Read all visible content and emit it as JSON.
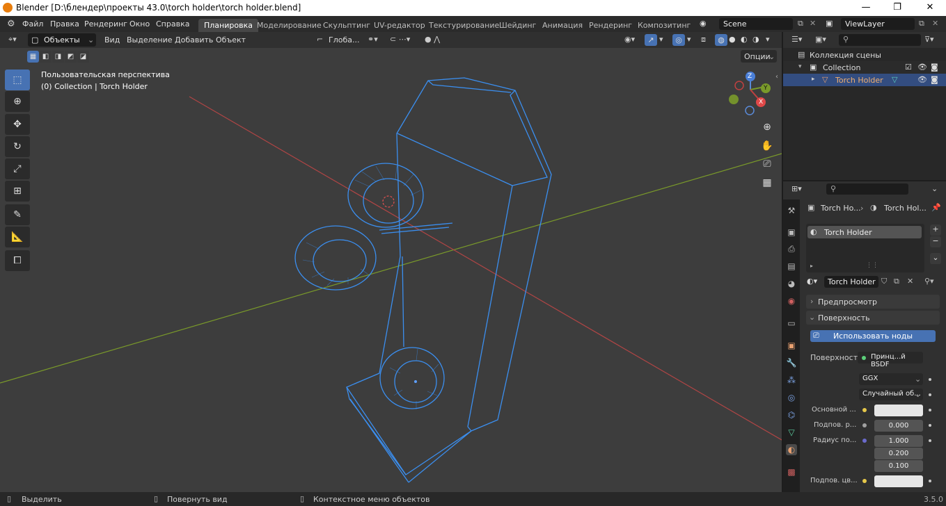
{
  "window": {
    "title": "Blender [D:\\блендер\\проекты 43.0\\torch holder\\torch holder.blend]",
    "minimize": "—",
    "maximize": "❐",
    "close": "✕"
  },
  "menu": {
    "items": [
      "Файл",
      "Правка",
      "Рендеринг",
      "Окно",
      "Справка"
    ]
  },
  "workspaces": {
    "tabs": [
      "Планировка",
      "Моделирование",
      "Скульптинг",
      "UV-редактор",
      "Текстурирование",
      "Шейдинг",
      "Анимация",
      "Рендеринг",
      "Композитинг"
    ],
    "active": "Планировка"
  },
  "scene": {
    "name": "Scene",
    "view_layer": "ViewLayer"
  },
  "viewport_header": {
    "mode": "Объекты",
    "menus": [
      "Вид",
      "Выделение",
      "Добавить",
      "Объект"
    ],
    "transform_orientation": "Глоба...",
    "options_label": "Опции"
  },
  "viewport": {
    "perspective_label": "Пользовательская перспектива",
    "collection_label": "(0) Collection | Torch Holder",
    "gizmo": {
      "x": "X",
      "y": "Y",
      "z": "Z"
    }
  },
  "outliner": {
    "scene_collection": "Коллекция сцены",
    "collection": "Collection",
    "object": "Torch Holder"
  },
  "properties": {
    "breadcrumb": [
      "Torch Ho...",
      "Torch Hol..."
    ],
    "material_slot": "Torch Holder",
    "material_name": "Torch Holder",
    "sections": {
      "preview": "Предпросмотр",
      "surface": "Поверхность"
    },
    "use_nodes_button": "Использовать ноды",
    "surface_label": "Поверхность",
    "surface_shader": "Принц...й BSDF",
    "distribution": "GGX",
    "subsurface_method": "Случайный об...",
    "rows": [
      {
        "label": "Основной ...",
        "value": ""
      },
      {
        "label": "Подпов. р...",
        "value": "0.000"
      },
      {
        "label": "Радиус по...",
        "value": "1.000"
      },
      {
        "label": "",
        "value": "0.200"
      },
      {
        "label": "",
        "value": "0.100"
      },
      {
        "label": "Подпов. цв...",
        "value": ""
      }
    ]
  },
  "statusbar": {
    "select": "Выделить",
    "rotate": "Повернуть вид",
    "context": "Контекстное меню объектов",
    "version": "3.5.0"
  },
  "colors": {
    "accent": "#4772b3",
    "wire": "#3b8ff0",
    "x_axis": "#c04040",
    "y_axis": "#7a9a2a",
    "orange": "#e87d0d"
  }
}
